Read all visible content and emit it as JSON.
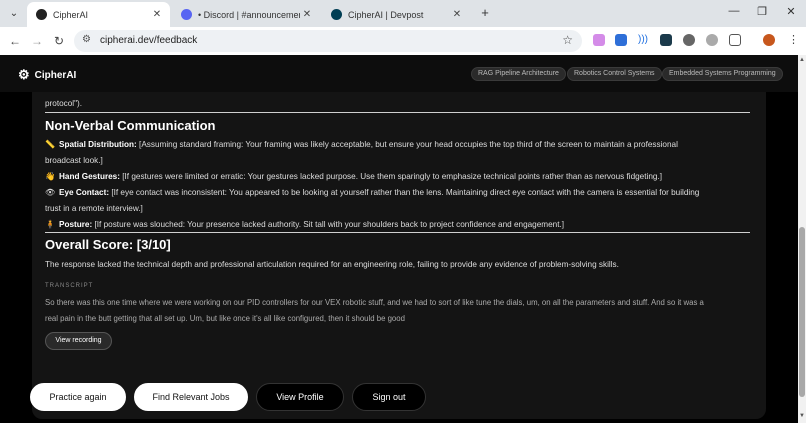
{
  "browser": {
    "tabs": [
      {
        "title": "CipherAI",
        "favicon_color": "#222222"
      },
      {
        "title": "• Discord | #announcements | A",
        "favicon_color": "#5865f2"
      },
      {
        "title": "CipherAI | Devpost",
        "favicon_color": "#003e54"
      }
    ],
    "new_tab": "+",
    "url": "cipherai.dev/feedback",
    "window_controls": {
      "minimize": "—",
      "maximize": "❐",
      "close": "✕"
    }
  },
  "site": {
    "brand": "CipherAI",
    "header_pills": [
      "RAG Pipeline Architecture",
      "Robotics Control Systems",
      "Embedded Systems Programming"
    ]
  },
  "feedback": {
    "top_fragment": "protocol\").",
    "nonverbal_heading": "Non-Verbal Communication",
    "items": [
      {
        "icon": "📏",
        "label": "Spatial Distribution:",
        "text_line1": " [Assuming standard framing: Your framing was likely acceptable, but ensure your head occupies the top third of the screen to maintain a professional",
        "text_line2": "broadcast look.]"
      },
      {
        "icon": "👋",
        "label": "Hand Gestures:",
        "text_line1": " [If gestures were limited or erratic: Your gestures lacked purpose. Use them sparingly to emphasize technical points rather than as nervous fidgeting.]",
        "text_line2": ""
      },
      {
        "icon": "👁",
        "label": "Eye Contact:",
        "text_line1": " [If eye contact was inconsistent: You appeared to be looking at yourself rather than the lens. Maintaining direct eye contact with the camera is essential for building",
        "text_line2": "trust in a remote interview.]"
      },
      {
        "icon": "🧍",
        "label": "Posture:",
        "text_line1": " [If posture was slouched: Your presence lacked authority. Sit tall with your shoulders back to project confidence and engagement.]",
        "text_line2": ""
      }
    ],
    "score_heading": "Overall Score: [3/10]",
    "summary": "The response lacked the technical depth and professional articulation required for an engineering role, failing to provide any evidence of problem-solving skills.",
    "transcript_label": "TRANSCRIPT",
    "transcript_line1": "So there was this one time where we were working on our PID controllers for our VEX robotic stuff, and we had to sort of like tune the dials, um, on all the parameters and stuff. And so it was a",
    "transcript_line2": "real pain in the butt getting that all set up. Um, but like once it's all like configured, then it should be good",
    "view_recording": "View recording"
  },
  "actions": {
    "practice_again": "Practice again",
    "find_jobs": "Find Relevant Jobs",
    "view_profile": "View Profile",
    "sign_out": "Sign out"
  }
}
